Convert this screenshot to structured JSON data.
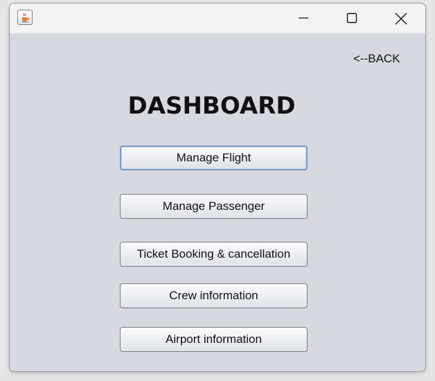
{
  "window": {
    "icon": "java-cup-icon",
    "controls": {
      "minimize_icon": "minimize-icon",
      "maximize_icon": "maximize-icon",
      "close_icon": "close-icon"
    }
  },
  "dashboard": {
    "back_label": "<--BACK",
    "title": "DASHBOARD",
    "buttons": [
      {
        "label": "Manage Flight",
        "focused": true
      },
      {
        "label": "Manage Passenger"
      },
      {
        "label": "Ticket Booking & cancellation"
      },
      {
        "label": "Crew information"
      },
      {
        "label": "Airport information"
      }
    ]
  },
  "colors": {
    "content_bg": "#d6d9e0",
    "titlebar_bg": "#f3f3f3",
    "focus_border": "#7a9bc8"
  }
}
